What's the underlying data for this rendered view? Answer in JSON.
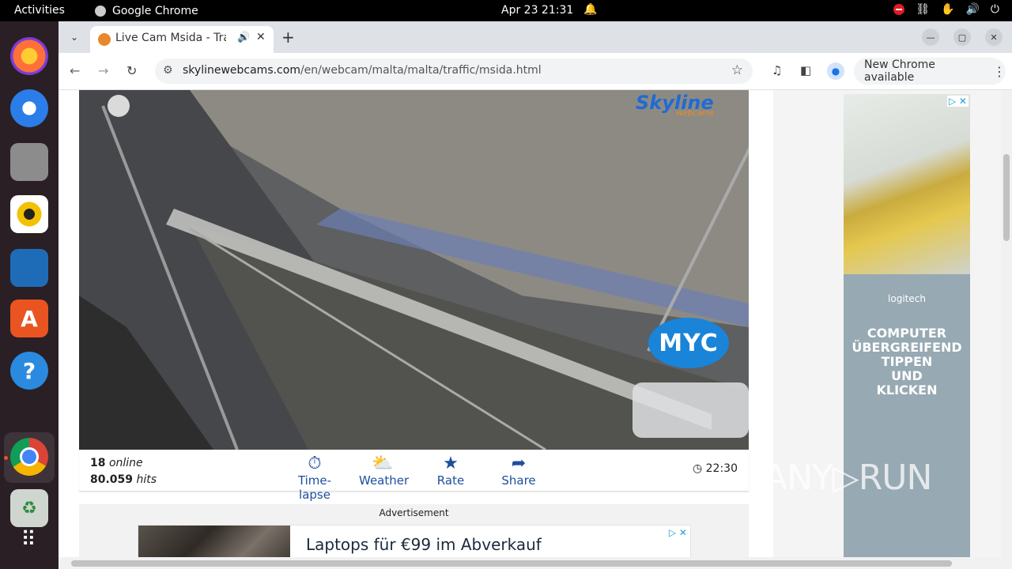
{
  "topbar": {
    "activities": "Activities",
    "app_name": "Google Chrome",
    "datetime": "Apr 23  21:31"
  },
  "dock": {
    "items": [
      "firefox-icon",
      "thunderbird-icon",
      "files-icon",
      "rhythmbox-icon",
      "writer-icon",
      "software-icon",
      "help-icon",
      "chrome-icon",
      "trash-icon",
      "apps-grid-icon"
    ]
  },
  "browser": {
    "tab_title": "Live Cam Msida - Traffi",
    "url_host": "skylinewebcams.com",
    "url_path": "/en/webcam/malta/malta/traffic/msida.html",
    "update_label": "New Chrome available"
  },
  "player": {
    "logo_main": "Skyline",
    "logo_sub": "webcams",
    "overlay_logo": "MYC"
  },
  "info": {
    "online_count": "18",
    "online_label": "online",
    "hits_count": "80.059",
    "hits_label": "hits",
    "actions": [
      {
        "label": "Time-lapse",
        "icon": "timelapse-icon"
      },
      {
        "label": "Weather",
        "icon": "weather-icon"
      },
      {
        "label": "Rate",
        "icon": "star-icon"
      },
      {
        "label": "Share",
        "icon": "share-icon"
      }
    ],
    "local_time": "22:30"
  },
  "ad_bottom": {
    "label": "Advertisement",
    "headline": "Laptops für €99 im Abverkauf"
  },
  "ad_side": {
    "brand": "logitech",
    "copy": "COMPUTER\nÜBERGREIFEND\nTIPPEN\nUND\nKLICKEN"
  },
  "watermark": "ANY▷RUN"
}
